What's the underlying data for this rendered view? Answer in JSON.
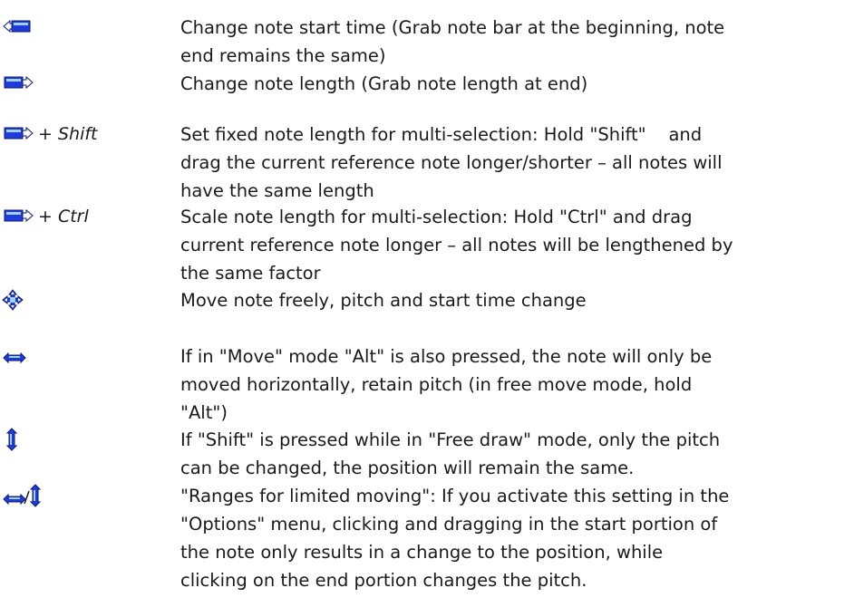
{
  "colors": {
    "cursor_blue": "#1f3bd8",
    "cursor_border": "#0d1a6e",
    "cursor_light": "#9fd0ff",
    "text": "#1a1a1a"
  },
  "rows": [
    {
      "icon": "start-time-cursor-icon",
      "modifier": null,
      "lines": [
        "Change note start time (Grab note bar at the beginning, note",
        "end remains the same)"
      ]
    },
    {
      "icon": "length-cursor-icon",
      "modifier": null,
      "lines": [
        "Change note length (Grab note length at end)"
      ]
    },
    {
      "icon": "length-cursor-icon",
      "modifier": {
        "plus": "+",
        "key": "Shift"
      },
      "lines": [
        "Set fixed note length for multi-selection: Hold \"Shift\"    and",
        "drag the current reference note longer/shorter – all notes will",
        "have the same length"
      ]
    },
    {
      "icon": "length-cursor-icon",
      "modifier": {
        "plus": "+",
        "key": "Ctrl"
      },
      "lines": [
        "Scale note length for multi-selection: Hold \"Ctrl\" and drag",
        "current reference note longer – all notes will be lengthened by",
        "the same factor"
      ]
    },
    {
      "icon": "move-cursor-icon",
      "modifier": null,
      "lines": [
        "Move note freely, pitch and start time change"
      ]
    },
    {
      "icon": "horizontal-move-cursor-icon",
      "modifier": null,
      "lines": [
        "If in \"Move\" mode \"Alt\" is also pressed, the note will only be",
        "moved horizontally, retain pitch (in free move mode, hold",
        "\"Alt\")"
      ]
    },
    {
      "icon": "vertical-move-cursor-icon",
      "modifier": null,
      "lines": [
        "If \"Shift\" is pressed while in \"Free draw\" mode, only the pitch",
        "can be changed, the position will remain the same."
      ]
    },
    {
      "icon": "range-move-cursor-icon",
      "modifier": null,
      "lines": [
        "\"Ranges for limited moving\": If you activate this setting in the",
        "\"Options\" menu, clicking and dragging in the start portion of",
        "the note only results in a change to the position, while",
        "clicking on the end portion changes the pitch."
      ]
    }
  ]
}
